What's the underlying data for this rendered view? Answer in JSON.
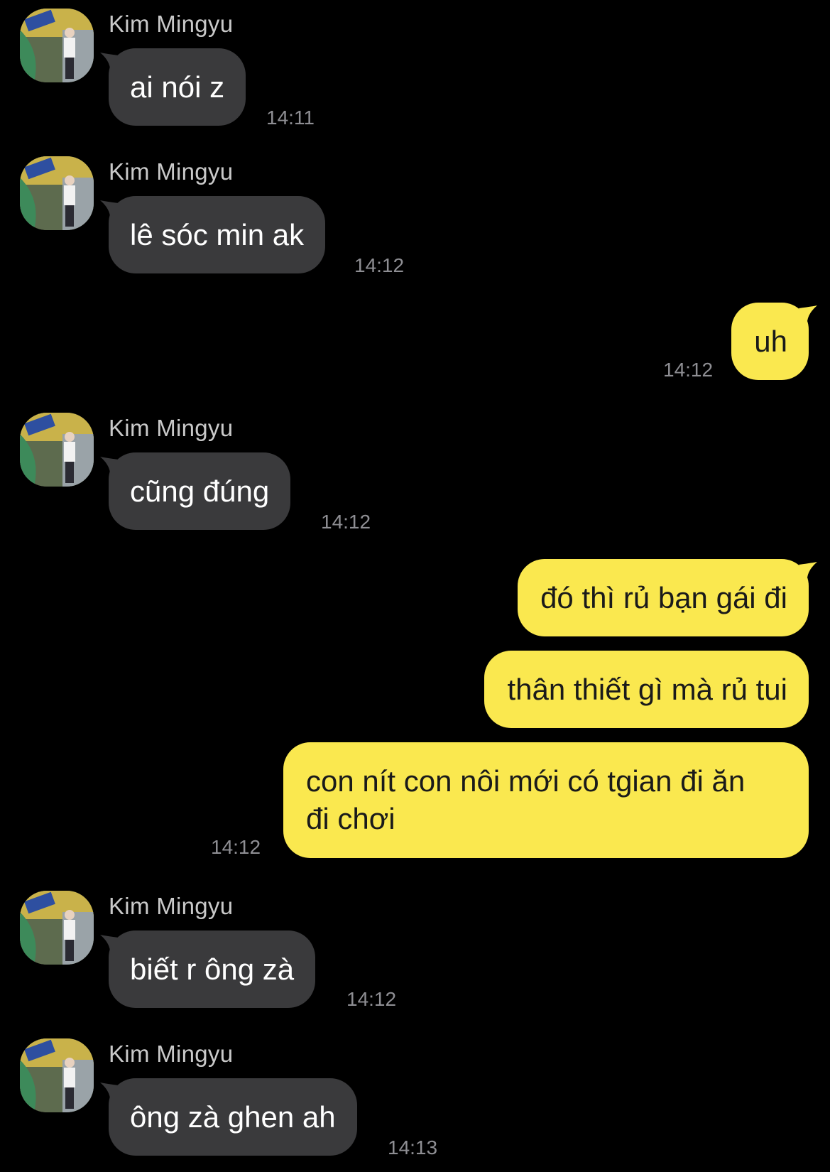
{
  "conversation": {
    "messages": [
      {
        "from": "other",
        "sender": "Kim Mingyu",
        "text": "ai nói z",
        "time": "14:11"
      },
      {
        "from": "other",
        "sender": "Kim Mingyu",
        "text": "lê sóc min ak",
        "time": "14:12"
      },
      {
        "from": "me",
        "text": "uh",
        "time": "14:12"
      },
      {
        "from": "other",
        "sender": "Kim Mingyu",
        "text": "cũng đúng",
        "time": "14:12"
      },
      {
        "from": "me",
        "text": "đó thì rủ bạn gái đi"
      },
      {
        "from": "me",
        "text": "thân thiết gì mà rủ tui"
      },
      {
        "from": "me",
        "text_line1": "con nít con nôi mới có tgian đi ăn",
        "text_line2": "đi chơi",
        "time": "14:12"
      },
      {
        "from": "other",
        "sender": "Kim Mingyu",
        "text": "biết r ông zà",
        "time": "14:12"
      },
      {
        "from": "other",
        "sender": "Kim Mingyu",
        "text": "ông zà ghen ah",
        "time": "14:13"
      }
    ]
  },
  "colors": {
    "background": "#000000",
    "incoming_bubble": "#3a3a3c",
    "outgoing_bubble": "#fae84f",
    "sender_name": "#c9c9c9",
    "timestamp": "#8e8e93"
  }
}
